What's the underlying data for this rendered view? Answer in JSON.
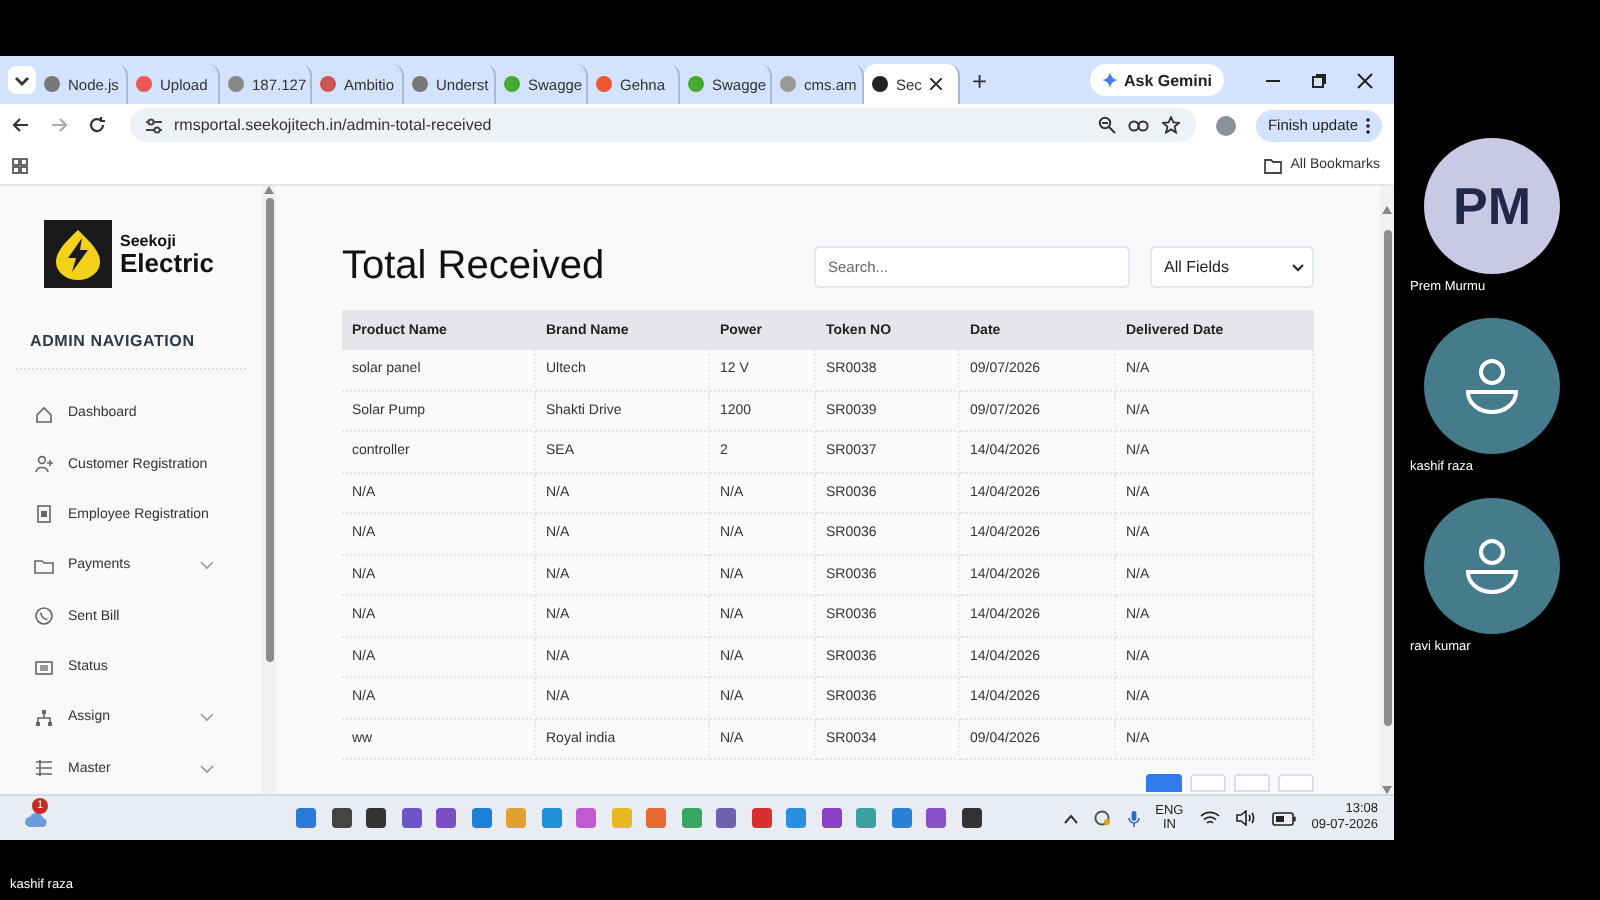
{
  "shared_screen": {
    "browser_tabs": [
      {
        "label": "Node.js",
        "selected": false
      },
      {
        "label": "Upload",
        "selected": false
      },
      {
        "label": "187.127",
        "selected": false
      },
      {
        "label": "Ambitio",
        "selected": false
      },
      {
        "label": "Underst",
        "selected": false
      },
      {
        "label": "Swagge",
        "selected": false
      },
      {
        "label": "Gehna",
        "selected": false
      },
      {
        "label": "Swagge",
        "selected": false
      },
      {
        "label": "cms.am",
        "selected": false
      },
      {
        "label": "Sec",
        "selected": true
      }
    ],
    "new_tab": "+",
    "gemini_button": "Ask Gemini",
    "address": "rmsportal.seekojitech.in/admin-total-received",
    "update_button": "Finish update",
    "bookmarks_label": "All Bookmarks",
    "logo": {
      "line1": "Seekoji",
      "line2": "Electric"
    },
    "nav_heading": "ADMIN NAVIGATION",
    "nav_items": [
      {
        "label": "Dashboard",
        "expandable": false
      },
      {
        "label": "Customer Registration",
        "expandable": false
      },
      {
        "label": "Employee Registration",
        "expandable": false
      },
      {
        "label": "Payments",
        "expandable": true
      },
      {
        "label": "Sent Bill",
        "expandable": false
      },
      {
        "label": "Status",
        "expandable": false
      },
      {
        "label": "Assign",
        "expandable": true
      },
      {
        "label": "Master",
        "expandable": true
      }
    ],
    "page_title": "Total Received",
    "search": {
      "placeholder": "Search..."
    },
    "filter": {
      "value": "All Fields"
    },
    "table": {
      "columns": [
        "Product Name",
        "Brand Name",
        "Power",
        "Token NO",
        "Date",
        "Delivered Date"
      ],
      "rows": [
        [
          "solar panel",
          "Ultech",
          "12 V",
          "SR0038",
          "09/07/2026",
          "N/A"
        ],
        [
          "Solar Pump",
          "Shakti Drive",
          "1200",
          "SR0039",
          "09/07/2026",
          "N/A"
        ],
        [
          "controller",
          "SEA",
          "2",
          "SR0037",
          "14/04/2026",
          "N/A"
        ],
        [
          "N/A",
          "N/A",
          "N/A",
          "SR0036",
          "14/04/2026",
          "N/A"
        ],
        [
          "N/A",
          "N/A",
          "N/A",
          "SR0036",
          "14/04/2026",
          "N/A"
        ],
        [
          "N/A",
          "N/A",
          "N/A",
          "SR0036",
          "14/04/2026",
          "N/A"
        ],
        [
          "N/A",
          "N/A",
          "N/A",
          "SR0036",
          "14/04/2026",
          "N/A"
        ],
        [
          "N/A",
          "N/A",
          "N/A",
          "SR0036",
          "14/04/2026",
          "N/A"
        ],
        [
          "N/A",
          "N/A",
          "N/A",
          "SR0036",
          "14/04/2026",
          "N/A"
        ],
        [
          "ww",
          "Royal india",
          "N/A",
          "SR0034",
          "09/04/2026",
          "N/A"
        ]
      ]
    },
    "pagination": [
      {
        "selected": true
      },
      {
        "selected": false
      },
      {
        "selected": false
      },
      {
        "selected": false
      }
    ],
    "taskbar": {
      "badge": "1",
      "language": "ENG",
      "region": "IN",
      "time": "13:08",
      "date": "09-07-2026"
    }
  },
  "participants": [
    {
      "kind": "initials",
      "initials": "PM",
      "name": "Prem Murmu"
    },
    {
      "kind": "silhouette",
      "name": "kashif raza"
    },
    {
      "kind": "silhouette",
      "name": "ravi kumar"
    }
  ],
  "presenter_caption": "kashif raza"
}
